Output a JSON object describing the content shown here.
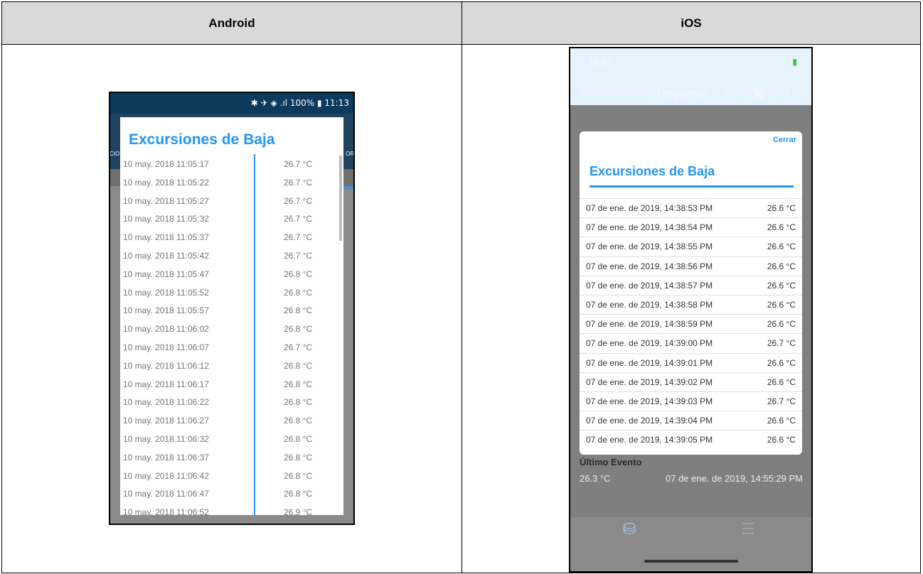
{
  "headers": {
    "left": "Android",
    "right": "iOS"
  },
  "android": {
    "status_text": "✱ ✈ ◈ .ıl 100% ▮ 11:13",
    "tab_fragment_left": "CIO",
    "tab_fragment_right": "OR",
    "dialog_title": "Excursiones de Baja",
    "rows": [
      {
        "date": "10 may. 2018 11:05:17",
        "temp": "26.7 °C"
      },
      {
        "date": "10 may. 2018 11:05:22",
        "temp": "26.7 °C"
      },
      {
        "date": "10 may. 2018 11:05:27",
        "temp": "26.7 °C"
      },
      {
        "date": "10 may. 2018 11:05:32",
        "temp": "26.7 °C"
      },
      {
        "date": "10 may. 2018 11:05:37",
        "temp": "26.7 °C"
      },
      {
        "date": "10 may. 2018 11:05:42",
        "temp": "26.7 °C"
      },
      {
        "date": "10 may. 2018 11:05:47",
        "temp": "26.8 °C"
      },
      {
        "date": "10 may. 2018 11:05:52",
        "temp": "26.8 °C"
      },
      {
        "date": "10 may. 2018 11:05:57",
        "temp": "26.8 °C"
      },
      {
        "date": "10 may. 2018 11:06:02",
        "temp": "26.8 °C"
      },
      {
        "date": "10 may. 2018 11:06:07",
        "temp": "26.7 °C"
      },
      {
        "date": "10 may. 2018 11:06:12",
        "temp": "26.8 °C"
      },
      {
        "date": "10 may. 2018 11:06:17",
        "temp": "26.8 °C"
      },
      {
        "date": "10 may. 2018 11:06:22",
        "temp": "26.8 °C"
      },
      {
        "date": "10 may. 2018 11:06:27",
        "temp": "26.8 °C"
      },
      {
        "date": "10 may. 2018 11:06:32",
        "temp": "26.8 °C"
      },
      {
        "date": "10 may. 2018 11:06:37",
        "temp": "26.8 °C"
      },
      {
        "date": "10 may. 2018 11:06:42",
        "temp": "26.8 °C"
      },
      {
        "date": "10 may. 2018 11:06:47",
        "temp": "26.8 °C"
      },
      {
        "date": "10 may. 2018 11:06:52",
        "temp": "26.9 °C"
      }
    ]
  },
  "ios": {
    "time": "14:57",
    "nav_title": "Registros",
    "close_label": "Cerrar",
    "dialog_title": "Excursiones de Baja",
    "rows": [
      {
        "date": "07 de ene. de 2019, 14:38:53 PM",
        "temp": "26.6 °C"
      },
      {
        "date": "07 de ene. de 2019, 14:38:54 PM",
        "temp": "26.6 °C"
      },
      {
        "date": "07 de ene. de 2019, 14:38:55 PM",
        "temp": "26.6 °C"
      },
      {
        "date": "07 de ene. de 2019, 14:38:56 PM",
        "temp": "26.6 °C"
      },
      {
        "date": "07 de ene. de 2019, 14:38:57 PM",
        "temp": "26.6 °C"
      },
      {
        "date": "07 de ene. de 2019, 14:38:58 PM",
        "temp": "26.6 °C"
      },
      {
        "date": "07 de ene. de 2019, 14:38:59 PM",
        "temp": "26.6 °C"
      },
      {
        "date": "07 de ene. de 2019, 14:39:00 PM",
        "temp": "26.7 °C"
      },
      {
        "date": "07 de ene. de 2019, 14:39:01 PM",
        "temp": "26.6 °C"
      },
      {
        "date": "07 de ene. de 2019, 14:39:02 PM",
        "temp": "26.6 °C"
      },
      {
        "date": "07 de ene. de 2019, 14:39:03 PM",
        "temp": "26.7 °C"
      },
      {
        "date": "07 de ene. de 2019, 14:39:04 PM",
        "temp": "26.6 °C"
      },
      {
        "date": "07 de ene. de 2019, 14:39:05 PM",
        "temp": "26.6 °C"
      }
    ],
    "last_event_label": "Último Evento",
    "last_event_temp": "26.3 °C",
    "last_event_date": "07 de ene. de 2019, 14:55:29 PM",
    "icons": [
      "back-icon",
      "share-icon",
      "save-icon",
      "download-icon",
      "database-icon",
      "menu-icon"
    ]
  }
}
